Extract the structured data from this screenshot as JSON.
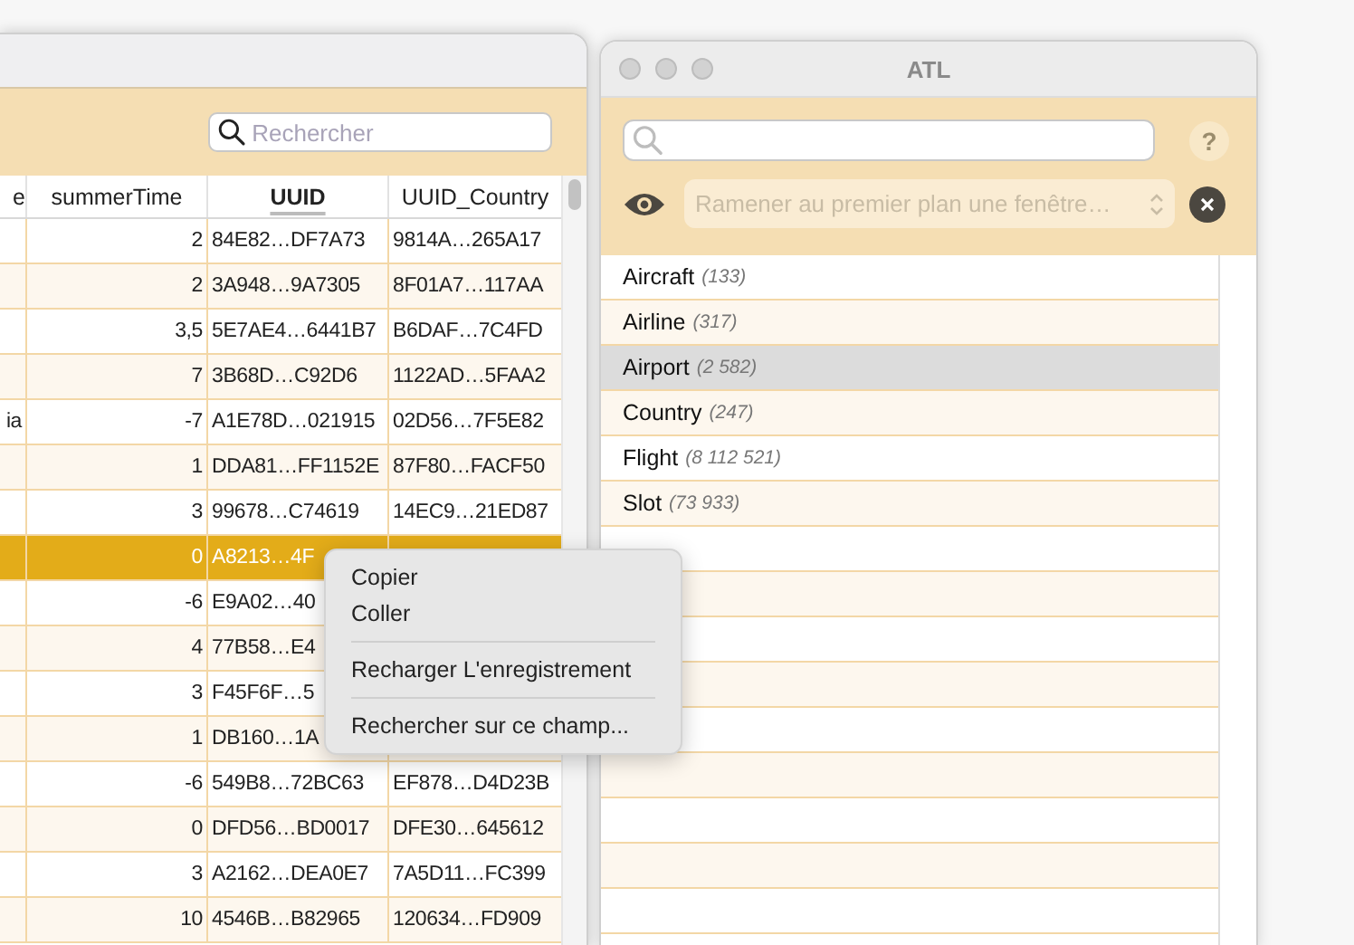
{
  "left_window": {
    "search": {
      "placeholder": "Rechercher"
    },
    "table": {
      "columns": [
        {
          "label": "e",
          "sorted": false
        },
        {
          "label": "summerTime",
          "sorted": false
        },
        {
          "label": "UUID",
          "sorted": true
        },
        {
          "label": "UUID_Country",
          "sorted": false
        }
      ],
      "rows": [
        {
          "selected": false,
          "cells": [
            "",
            "2",
            "84E82…DF7A73",
            "9814A…265A17"
          ]
        },
        {
          "selected": false,
          "cells": [
            "",
            "2",
            "3A948…9A7305",
            "8F01A7…117AA"
          ]
        },
        {
          "selected": false,
          "cells": [
            "",
            "3,5",
            "5E7AE4…6441B7",
            "B6DAF…7C4FD"
          ]
        },
        {
          "selected": false,
          "cells": [
            "",
            "7",
            "3B68D…C92D6",
            "1122AD…5FAA2"
          ]
        },
        {
          "selected": false,
          "cells": [
            "ia",
            "-7",
            "A1E78D…021915",
            "02D56…7F5E82"
          ]
        },
        {
          "selected": false,
          "cells": [
            "",
            "1",
            "DDA81…FF1152E",
            "87F80…FACF50"
          ]
        },
        {
          "selected": false,
          "cells": [
            "",
            "3",
            "99678…C74619",
            "14EC9…21ED87"
          ]
        },
        {
          "selected": true,
          "cells": [
            "",
            "0",
            "A8213…4F",
            ""
          ]
        },
        {
          "selected": false,
          "cells": [
            "",
            "-6",
            "E9A02…40",
            ""
          ]
        },
        {
          "selected": false,
          "cells": [
            "",
            "4",
            "77B58…E4",
            ""
          ]
        },
        {
          "selected": false,
          "cells": [
            "",
            "3",
            "F45F6F…5",
            ""
          ]
        },
        {
          "selected": false,
          "cells": [
            "",
            "1",
            "DB160…1A",
            ""
          ]
        },
        {
          "selected": false,
          "cells": [
            "",
            "-6",
            "549B8…72BC63",
            "EF878…D4D23B"
          ]
        },
        {
          "selected": false,
          "cells": [
            "",
            "0",
            "DFD56…BD0017",
            "DFE30…645612"
          ]
        },
        {
          "selected": false,
          "cells": [
            "",
            "3",
            "A2162…DEA0E7",
            "7A5D11…FC399"
          ]
        },
        {
          "selected": false,
          "cells": [
            "",
            "10",
            "4546B…B82965",
            "120634…FD909"
          ]
        }
      ]
    }
  },
  "context_menu": {
    "items": [
      {
        "kind": "item",
        "label": "Copier"
      },
      {
        "kind": "item",
        "label": "Coller"
      },
      {
        "kind": "separator"
      },
      {
        "kind": "item",
        "label": "Recharger L'enregistrement"
      },
      {
        "kind": "separator"
      },
      {
        "kind": "item",
        "label": "Rechercher sur ce champ..."
      }
    ]
  },
  "right_window": {
    "title": "ATL",
    "help": "?",
    "window_select": {
      "placeholder": "Ramener au premier plan une fenêtre…"
    },
    "list": [
      {
        "name": "Aircraft",
        "count": "(133)",
        "selected": false
      },
      {
        "name": "Airline",
        "count": "(317)",
        "selected": false
      },
      {
        "name": "Airport",
        "count": "(2 582)",
        "selected": true
      },
      {
        "name": "Country",
        "count": "(247)",
        "selected": false
      },
      {
        "name": "Flight",
        "count": "(8 112 521)",
        "selected": false
      },
      {
        "name": "Slot",
        "count": "(73 933)",
        "selected": false
      }
    ]
  }
}
